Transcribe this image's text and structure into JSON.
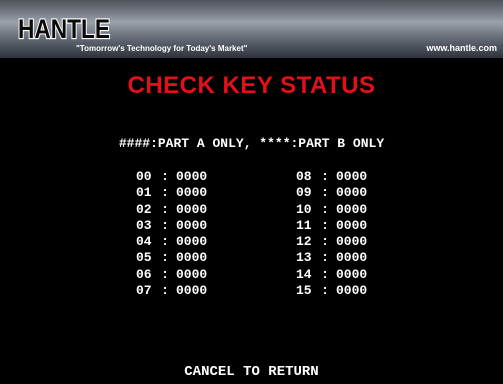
{
  "header": {
    "logo_text": "HANTLE",
    "tagline": "\"Tomorrow's Technology for Today's Market\"",
    "website": "www.hantle.com"
  },
  "title": "CHECK KEY STATUS",
  "legend": "####:PART A ONLY, ****:PART B ONLY",
  "keys_left": [
    {
      "num": "00",
      "sep": ":",
      "value": "0000"
    },
    {
      "num": "01",
      "sep": ":",
      "value": "0000"
    },
    {
      "num": "02",
      "sep": ":",
      "value": "0000"
    },
    {
      "num": "03",
      "sep": ":",
      "value": "0000"
    },
    {
      "num": "04",
      "sep": ":",
      "value": "0000"
    },
    {
      "num": "05",
      "sep": ":",
      "value": "0000"
    },
    {
      "num": "06",
      "sep": ":",
      "value": "0000"
    },
    {
      "num": "07",
      "sep": ":",
      "value": "0000"
    }
  ],
  "keys_right": [
    {
      "num": "08",
      "sep": ":",
      "value": "0000"
    },
    {
      "num": "09",
      "sep": ":",
      "value": "0000"
    },
    {
      "num": "10",
      "sep": ":",
      "value": "0000"
    },
    {
      "num": "11",
      "sep": ":",
      "value": "0000"
    },
    {
      "num": "12",
      "sep": ":",
      "value": "0000"
    },
    {
      "num": "13",
      "sep": ":",
      "value": "0000"
    },
    {
      "num": "14",
      "sep": ":",
      "value": "0000"
    },
    {
      "num": "15",
      "sep": ":",
      "value": "0000"
    }
  ],
  "footer": "CANCEL TO RETURN",
  "colors": {
    "background": "#000000",
    "title": "#e3101a",
    "text": "#ffffff"
  }
}
